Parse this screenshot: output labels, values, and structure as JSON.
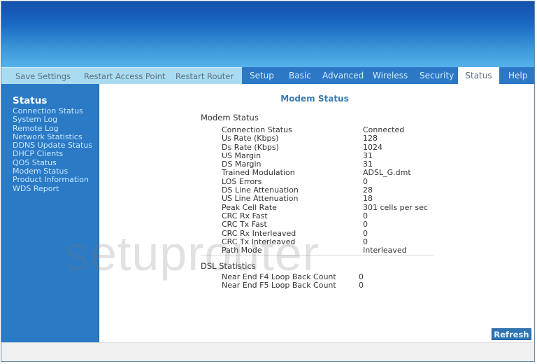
{
  "header": {
    "left_menu": [
      "Save Settings",
      "Restart Access Point",
      "Restart Router"
    ],
    "tabs": [
      "Setup",
      "Basic",
      "Advanced",
      "Wireless",
      "Security",
      "Status",
      "Help"
    ],
    "active_tab": "Status"
  },
  "sidebar": {
    "title": "Status",
    "items": [
      "Connection Status",
      "System Log",
      "Remote Log",
      "Network Statistics",
      "DDNS Update Status",
      "DHCP Clients",
      "QOS Status",
      "Modem Status",
      "Product Information",
      "WDS Report"
    ]
  },
  "main": {
    "page_title": "Modem Status",
    "modem_section_title": "Modem Status",
    "modem_rows": [
      {
        "label": "Connection Status",
        "value": "Connected"
      },
      {
        "label": "Us Rate (Kbps)",
        "value": "128"
      },
      {
        "label": "Ds Rate (Kbps)",
        "value": "1024"
      },
      {
        "label": "US Margin",
        "value": "31"
      },
      {
        "label": "DS Margin",
        "value": "31"
      },
      {
        "label": "Trained Modulation",
        "value": "ADSL_G.dmt"
      },
      {
        "label": "LOS Errors",
        "value": "0"
      },
      {
        "label": "DS Line Attenuation",
        "value": "28"
      },
      {
        "label": "US Line Attenuation",
        "value": "18"
      },
      {
        "label": "Peak Cell Rate",
        "value": "301 cells per sec"
      },
      {
        "label": "CRC Rx Fast",
        "value": "0"
      },
      {
        "label": "CRC Tx Fast",
        "value": "0"
      },
      {
        "label": "CRC Rx Interleaved",
        "value": "0"
      },
      {
        "label": "CRC Tx Interleaved",
        "value": "0"
      },
      {
        "label": "Path Mode",
        "value": "Interleaved"
      }
    ],
    "dsl_section_title": "DSL Statistics",
    "dsl_rows": [
      {
        "label": "Near End F4 Loop Back Count",
        "value": "0"
      },
      {
        "label": "Near End F5 Loop Back Count",
        "value": "0"
      }
    ],
    "refresh_label": "Refresh"
  },
  "watermark": "setuprouter"
}
